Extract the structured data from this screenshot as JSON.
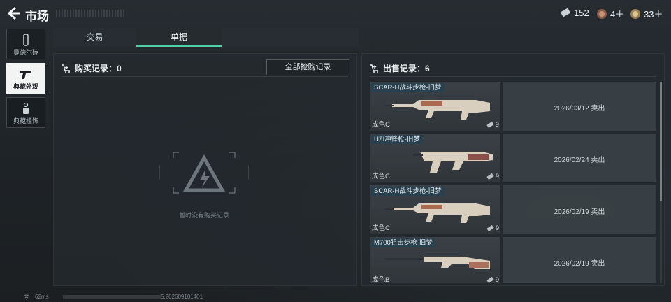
{
  "header": {
    "title": "市场"
  },
  "currencies": [
    {
      "icon": "ticket-icon",
      "value": "152"
    },
    {
      "icon": "coin-bronze-icon",
      "value": "4＋"
    },
    {
      "icon": "coin-gold-icon",
      "value": "33＋"
    }
  ],
  "rail": [
    {
      "label": "曼德尔砖",
      "icon": "brick-icon",
      "active": false
    },
    {
      "label": "典藏外观",
      "icon": "pistol-icon",
      "active": true
    },
    {
      "label": "典藏挂饰",
      "icon": "charm-icon",
      "active": false
    }
  ],
  "tabs": [
    {
      "label": "交易",
      "active": false
    },
    {
      "label": "单据",
      "active": true
    }
  ],
  "purchase": {
    "title": "购买记录：0",
    "all_button": "全部抢购记录",
    "empty_text": "暂时没有购买记录"
  },
  "sales": {
    "title": "出售记录：6",
    "items": [
      {
        "name": "SCAR-H战斗步枪-旧梦",
        "quality": "成色C",
        "price": "9",
        "sold": "2026/03/12 卖出",
        "gun": "rifle"
      },
      {
        "name": "UZI冲锋枪-旧梦",
        "quality": "成色C",
        "price": "9",
        "sold": "2026/02/24 卖出",
        "gun": "smg"
      },
      {
        "name": "SCAR-H战斗步枪-旧梦",
        "quality": "成色C",
        "price": "9",
        "sold": "2026/02/19 卖出",
        "gun": "rifle"
      },
      {
        "name": "M700狙击步枪-旧梦",
        "quality": "成色B",
        "price": "9",
        "sold": "2026/02/19 卖出",
        "gun": "sniper"
      }
    ]
  },
  "status": {
    "ping": "62ms",
    "build": "5.202609101401"
  },
  "colors": {
    "accent": "#4fd1a2",
    "active_rail": "#f2f4f4",
    "name_tag": "#29404e"
  }
}
